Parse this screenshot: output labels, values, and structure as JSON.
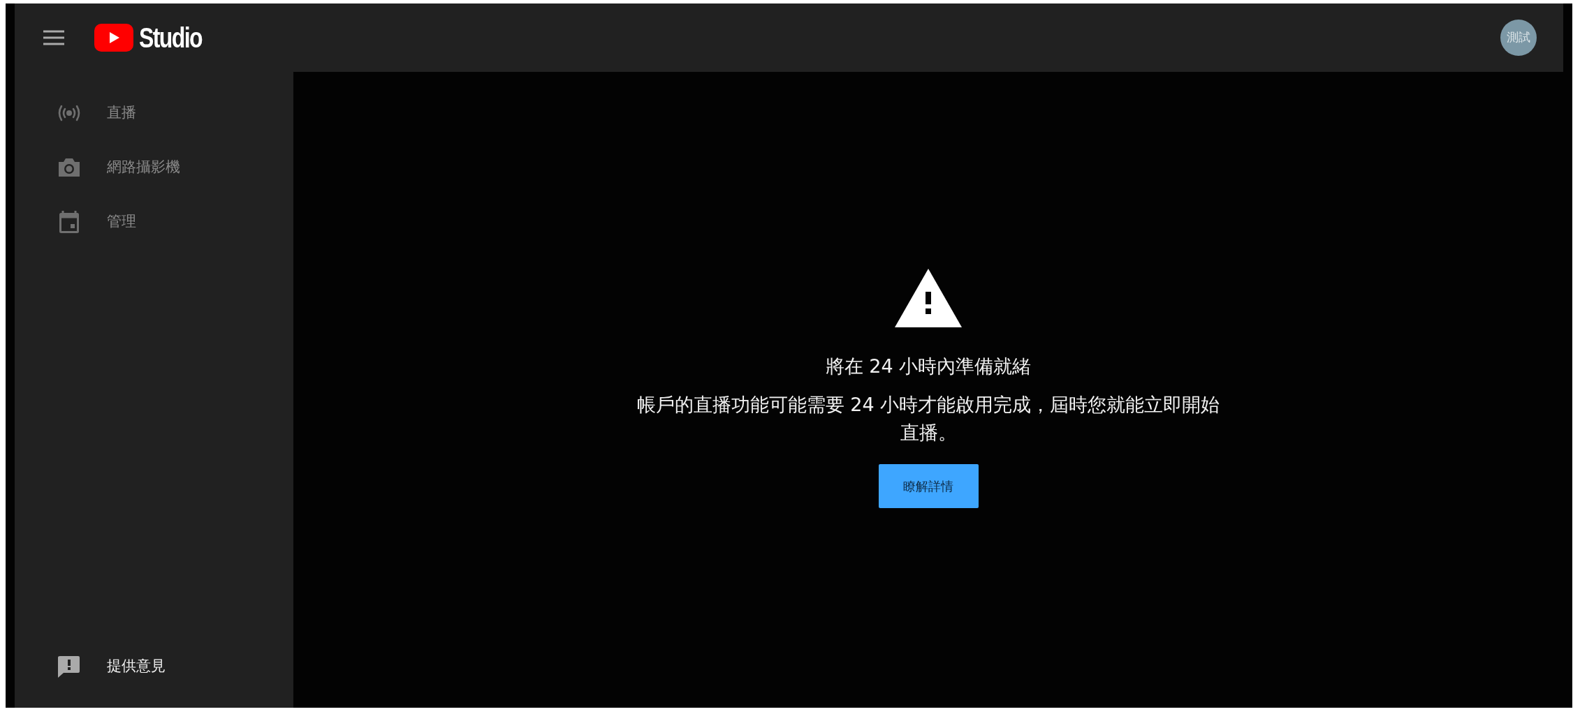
{
  "header": {
    "logo_text": "Studio",
    "avatar": "測試"
  },
  "sidebar": {
    "items": [
      {
        "kind": "live",
        "label": "直播",
        "disabled": true
      },
      {
        "kind": "camera",
        "label": "網路攝影機",
        "disabled": true
      },
      {
        "kind": "calendar",
        "label": "管理",
        "disabled": true
      }
    ],
    "footer": [
      {
        "kind": "feedback",
        "label": "提供意見",
        "disabled": false
      }
    ]
  },
  "notice": {
    "title": "將在 24 小時內準備就緒",
    "message": "帳戶的直播功能可能需要 24 小時才能啟用完成，屆時您就能立即開始直播。",
    "button": "瞭解詳情"
  }
}
